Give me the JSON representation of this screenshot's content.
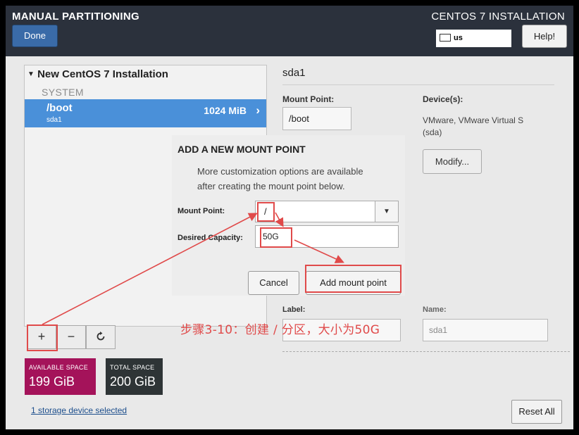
{
  "header": {
    "title": "MANUAL PARTITIONING",
    "done_label": "Done",
    "product": "CENTOS 7 INSTALLATION",
    "keyboard_layout": "us",
    "help_label": "Help!"
  },
  "left_panel": {
    "install_title": "New CentOS 7 Installation",
    "group": "SYSTEM",
    "partition": {
      "mount": "/boot",
      "device": "sda1",
      "size": "1024 MiB"
    },
    "toolbar": {
      "add": "+",
      "remove": "−",
      "refresh": "⟳"
    },
    "available": {
      "label": "AVAILABLE SPACE",
      "value": "199 GiB",
      "color": "#a4135a"
    },
    "total": {
      "label": "TOTAL SPACE",
      "value": "200 GiB",
      "color": "#2e3436"
    },
    "storage_link": "1 storage device selected"
  },
  "details": {
    "title": "sda1",
    "mount_point_label": "Mount Point:",
    "mount_point_value": "/boot",
    "devices_label": "Device(s):",
    "devices_line1": "VMware, VMware Virtual S",
    "devices_line2": "(sda)",
    "modify_label": "Modify...",
    "label_label": "Label:",
    "name_label": "Name:",
    "name_value": "sda1",
    "reset_label": "Reset All"
  },
  "dialog": {
    "title": "ADD A NEW MOUNT POINT",
    "desc_line1": "More customization options are available",
    "desc_line2": "after creating the mount point below.",
    "mount_label": "Mount Point:",
    "mount_value": "/",
    "capacity_label": "Desired Capacity:",
    "capacity_value": "50G",
    "cancel_label": "Cancel",
    "add_label": "Add mount point"
  },
  "annotation": {
    "text": "步骤3-10：创建 / 分区，大小为50G",
    "color": "#e04a4a"
  }
}
